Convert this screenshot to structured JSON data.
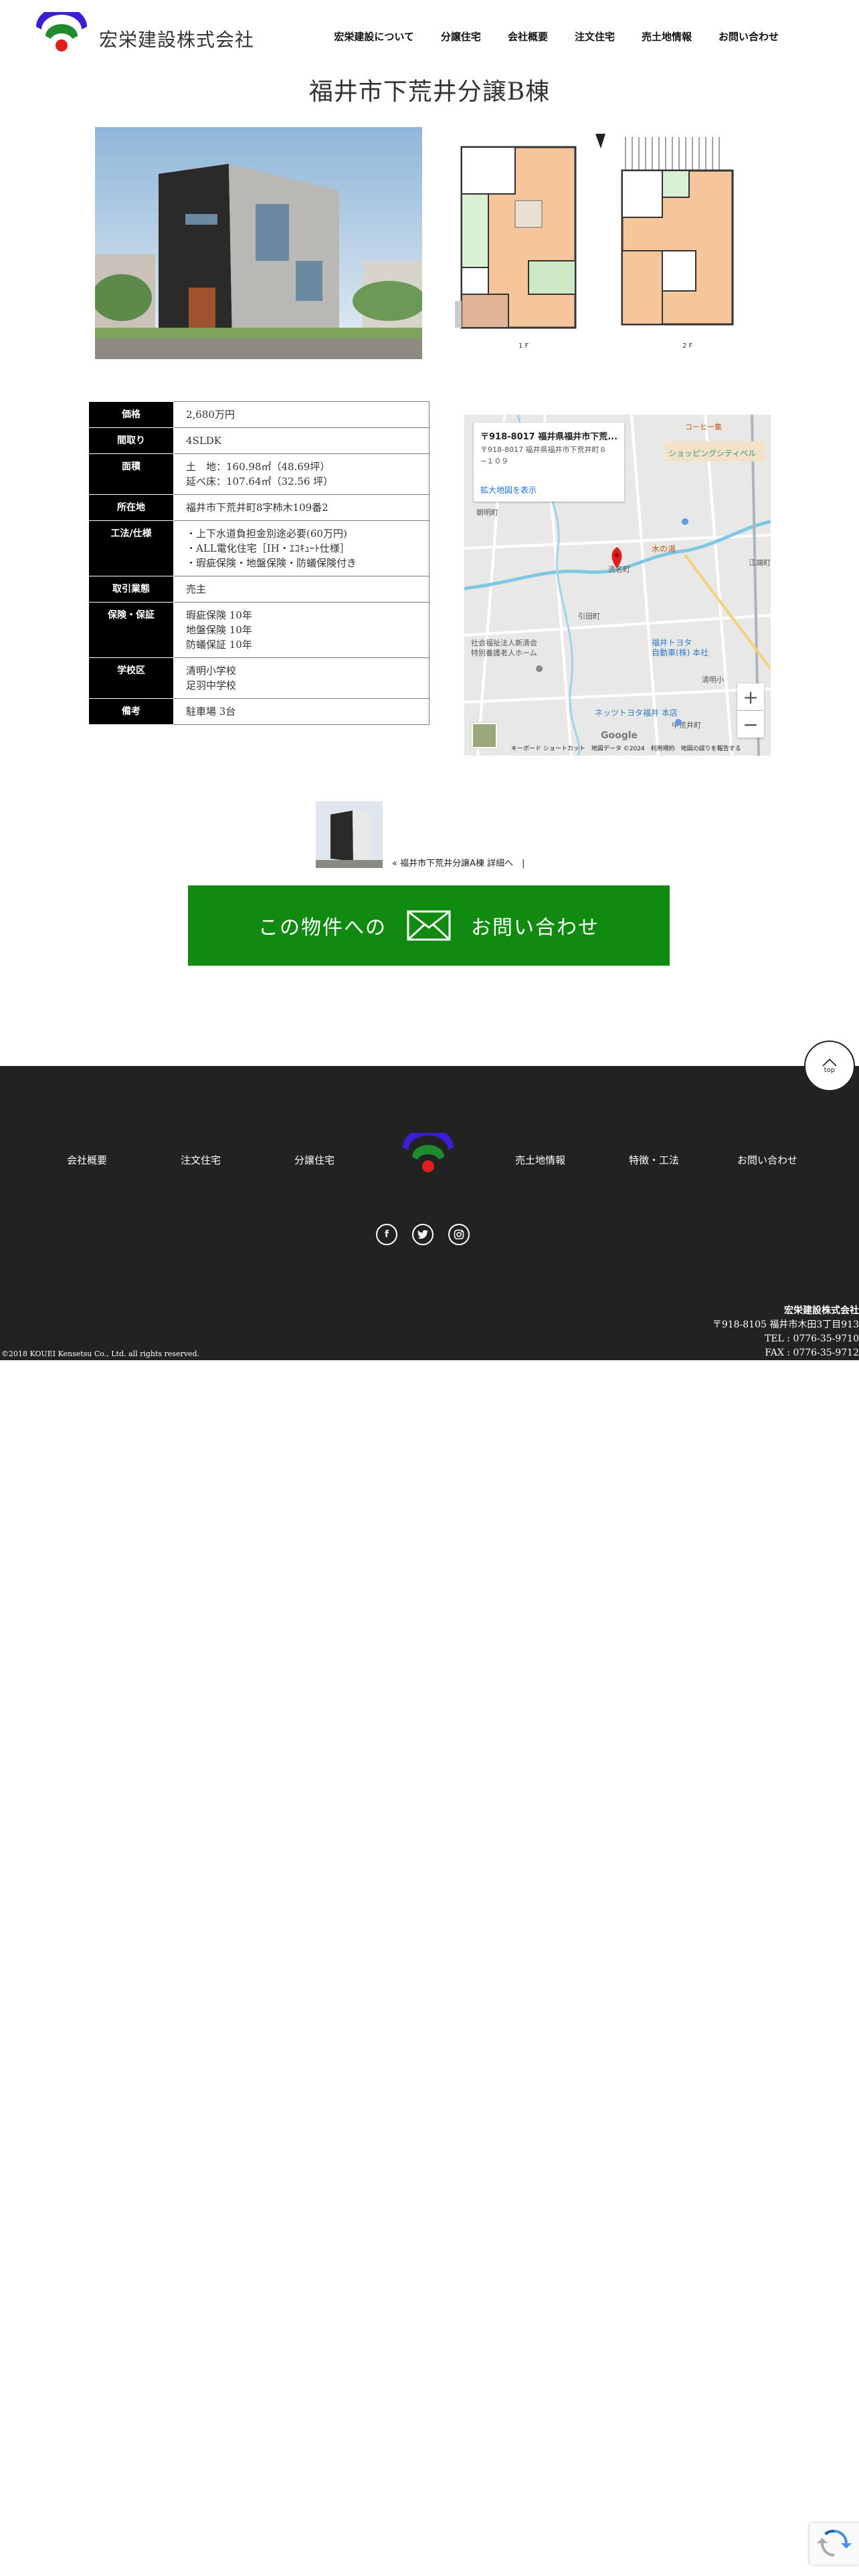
{
  "header": {
    "company_name": "宏栄建設株式会社",
    "nav": [
      "宏栄建設について",
      "分譲住宅",
      "会社概要",
      "注文住宅",
      "売土地情報",
      "お問い合わせ"
    ]
  },
  "page_title": "福井市下荒井分譲B棟",
  "floor_plan": {
    "floor1_label": "1 F",
    "floor2_label": "2 F"
  },
  "property": {
    "rows": [
      {
        "label": "価格",
        "values": [
          "2,680万円"
        ]
      },
      {
        "label": "間取り",
        "values": [
          "4SLDK"
        ]
      },
      {
        "label": "面積",
        "values": [
          "土　地：160.98㎡（48.69坪）",
          "延べ床：107.64㎡（32.56 坪）"
        ]
      },
      {
        "label": "所在地",
        "values": [
          "福井市下荒井町8字柿木109番2"
        ]
      },
      {
        "label": "工法/仕様",
        "values": [
          "・上下水道負担金別途必要(60万円)",
          "・ALL電化住宅［IH・ｴｺｷｭｰﾄ仕様］",
          "・瑕疵保険・地盤保険・防蟻保険付き"
        ]
      },
      {
        "label": "取引業態",
        "values": [
          "売主"
        ]
      },
      {
        "label": "保険・保証",
        "values": [
          "瑕疵保険 10年",
          "地盤保険 10年",
          "防蟻保証 10年"
        ]
      },
      {
        "label": "学校区",
        "values": [
          "清明小学校",
          "足羽中学校"
        ]
      },
      {
        "label": "備考",
        "values": [
          "駐車場 3台"
        ]
      }
    ]
  },
  "map": {
    "card_title": "〒918-8017 福井県福井市下荒...",
    "card_address": "〒918-8017 福井県福井市下荒井町８−１０９",
    "card_link": "拡大地図を表示",
    "labels": {
      "shop_top": "コーヒー集",
      "shopping_city": "ショッピングシティベル",
      "kinoyu": "木の湯",
      "akatsuki": "朝明町",
      "hikita": "引田町",
      "gogo": "洗名町",
      "nursing_1": "社会福祉法人新清会",
      "nursing_2": "特別養護老人ホーム",
      "toyota": "福井トヨタ",
      "toyota_2": "自動車(株) 本社",
      "netz": "ネッツトヨタ福井 本店",
      "shimoarai": "中荒井町",
      "seimei": "清明小",
      "egawa": "江端町"
    },
    "zoom_in": "+",
    "zoom_out": "−",
    "google": "Google",
    "footer": "キーボード ショートカット　地図データ ©2024　利用規約　地図の誤りを報告する"
  },
  "related": {
    "link": "« 福井市下荒井分譲A棟 詳細へ　|"
  },
  "contact": {
    "text_before": "この物件への",
    "text_after": "お問い合わせ"
  },
  "to_top": {
    "label": "top"
  },
  "footer": {
    "nav": [
      "会社概要",
      "注文住宅",
      "分譲住宅",
      "売土地情報",
      "特徴・工法",
      "お問い合わせ"
    ],
    "social": [
      "facebook-icon",
      "twitter-icon",
      "instagram-icon"
    ],
    "company_name": "宏栄建設株式会社",
    "address": "〒918-8105 福井市木田3丁目913",
    "tel": "TEL : 0776-35-9710",
    "fax": "FAX : 0776-35-9712",
    "copyright": "©2018 KOUEI Kensetsu Co., Ltd. all rights reserved."
  },
  "colors": {
    "logo_blue": "#3a1fd6",
    "logo_green": "#1f8a2e",
    "logo_red": "#e0201b",
    "contact_green": "#118b0f",
    "footer_bg": "#222222"
  }
}
